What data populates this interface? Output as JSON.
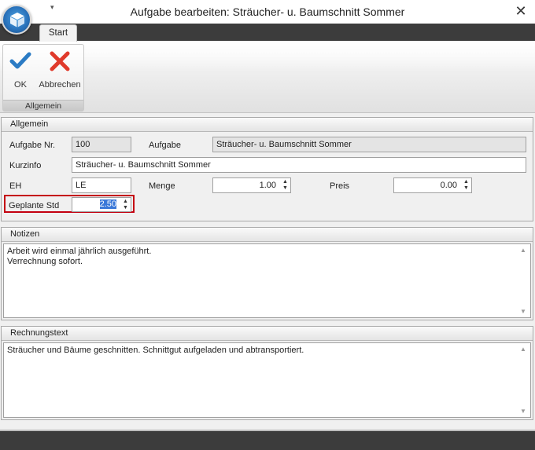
{
  "window": {
    "title": "Aufgabe bearbeiten: Sträucher- u. Baumschnitt Sommer",
    "close_glyph": "✕",
    "quick_access_glyph": "▾"
  },
  "ribbon": {
    "tabs": [
      {
        "label": "Start",
        "active": true
      }
    ],
    "groups": [
      {
        "label": "Allgemein",
        "buttons": [
          {
            "label": "OK",
            "icon": "checkmark-icon",
            "color": "#2b7bc4"
          },
          {
            "label": "Abbrechen",
            "icon": "red-x-icon",
            "color": "#e03a2b"
          }
        ]
      }
    ]
  },
  "allgemein": {
    "header": "Allgemein",
    "aufgabe_nr_label": "Aufgabe Nr.",
    "aufgabe_nr_value": "100",
    "aufgabe_label": "Aufgabe",
    "aufgabe_value": "Sträucher- u. Baumschnitt Sommer",
    "kurzinfo_label": "Kurzinfo",
    "kurzinfo_value": "Sträucher- u. Baumschnitt Sommer",
    "eh_label": "EH",
    "eh_value": "LE",
    "menge_label": "Menge",
    "menge_value": "1.00",
    "preis_label": "Preis",
    "preis_value": "0.00",
    "geplante_std_label": "Geplante Std",
    "geplante_std_value": "2.50",
    "highlight_color": "#c40010"
  },
  "notizen": {
    "header": "Notizen",
    "text": "Arbeit wird einmal jährlich ausgeführt.\nVerrechnung sofort."
  },
  "rechnungstext": {
    "header": "Rechnungstext",
    "text": "Sträucher und Bäume geschnitten. Schnittgut aufgeladen und abtransportiert."
  }
}
